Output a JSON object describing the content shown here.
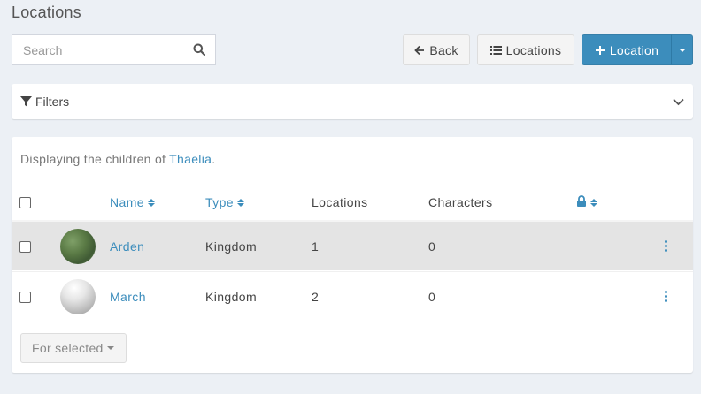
{
  "header": {
    "title": "Locations"
  },
  "search": {
    "placeholder": "Search",
    "value": ""
  },
  "toolbar": {
    "back_label": "Back",
    "locations_label": "Locations",
    "new_label": "Location"
  },
  "filters": {
    "label": "Filters"
  },
  "box": {
    "desc_prefix": "Displaying the children of ",
    "parent_link": "Thaelia",
    "desc_suffix": "."
  },
  "table": {
    "columns": [
      "Name",
      "Type",
      "Locations",
      "Characters"
    ],
    "rows": [
      {
        "name": "Arden",
        "type": "Kingdom",
        "locations": "1",
        "characters": "0"
      },
      {
        "name": "March",
        "type": "Kingdom",
        "locations": "2",
        "characters": "0"
      }
    ]
  },
  "bulk": {
    "label": "For selected"
  },
  "colors": {
    "primary": "#3c8dbc",
    "background": "#ecf0f5"
  }
}
